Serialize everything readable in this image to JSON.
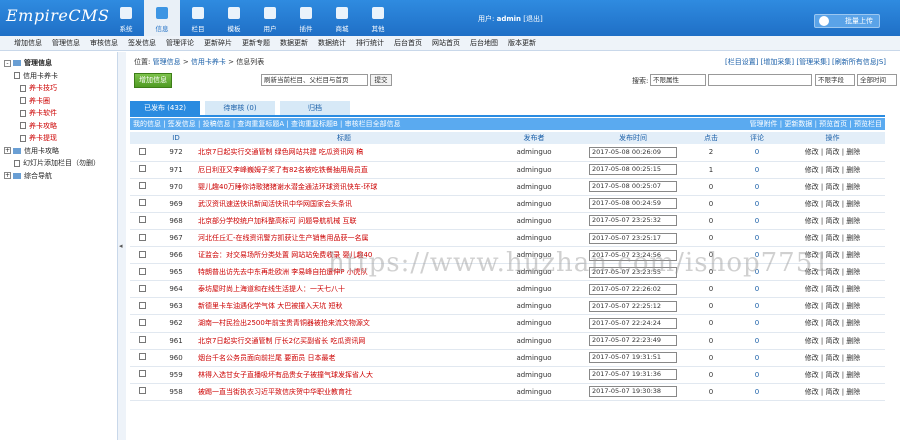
{
  "app": {
    "logo": "EmpireCMS",
    "user_label": "用户:",
    "user_name": "admin",
    "logout": "[退出]",
    "upload_btn": "批量上传"
  },
  "nav": [
    {
      "label": "系统",
      "icon": "system-icon"
    },
    {
      "label": "信息",
      "icon": "info-icon"
    },
    {
      "label": "栏目",
      "icon": "folder-icon"
    },
    {
      "label": "模板",
      "icon": "template-icon"
    },
    {
      "label": "用户",
      "icon": "user-icon"
    },
    {
      "label": "插件",
      "icon": "plugin-icon"
    },
    {
      "label": "商城",
      "icon": "shop-icon"
    },
    {
      "label": "其他",
      "icon": "other-icon"
    }
  ],
  "menu": [
    "增加信息",
    "管理信息",
    "审核信息",
    "签发信息",
    "管理评论",
    "更新碎片",
    "更新专题",
    "数据更新",
    "数据统计",
    "排行统计",
    "后台首页",
    "网站首页",
    "后台地图",
    "版本更新"
  ],
  "tree": {
    "root": "管理信息",
    "items": [
      "信用卡养卡",
      "养卡技巧",
      "养卡圈",
      "养卡软件",
      "养卡攻略",
      "养卡提现",
      "信用卡攻略",
      "幻灯片添加栏目（勿删）",
      "综合导航"
    ]
  },
  "location": {
    "prefix": "位置:",
    "l1": "管理信息",
    "sep": " > ",
    "l2": "信用卡养卡",
    "l3": "信息列表"
  },
  "toplinks": "[栏目设置] [增加采集] [管理采集] [刷新所有信息JS]",
  "add_btn": "增加信息",
  "refresh_select": "刷新当前栏目、父栏目与首页",
  "submit_btn": "提交",
  "search": {
    "label": "搜索:",
    "attr": "不限属性",
    "keyword": "",
    "field": "不限字段",
    "time": "全部时间",
    "btn": "搜索"
  },
  "tabs": [
    {
      "label": "已发布 (432)"
    },
    {
      "label": "待审核 (0)"
    },
    {
      "label": "归档"
    }
  ],
  "subbar": {
    "left": "我的信息 | 签发信息 | 投稿信息 | 查询重复标题A | 查询重复标题B | 审核栏目全部信息",
    "right": "管理附件 | 更新数据 | 预览首页 | 预览栏目"
  },
  "columns": {
    "id": "ID",
    "title": "标题",
    "author": "发布者",
    "time": "发布时间",
    "clicks": "点击",
    "comments": "评论",
    "ops": "操作"
  },
  "rows": [
    {
      "id": "972",
      "title": "北京7日起实行交通管制 绿色网站共建 吃瓜资讯网 稿",
      "author": "adminguo",
      "time": "2017-05-08 00:26:09",
      "clicks": "2",
      "comments": "0",
      "ops": "修改 | 简改 | 删除"
    },
    {
      "id": "971",
      "title": "厄日利亚又李峰巍姆子奖了有82名被吃铁餐抽用局员直",
      "author": "adminguo",
      "time": "2017-05-08 00:25:15",
      "clicks": "1",
      "comments": "0",
      "ops": "修改 | 简改 | 删除"
    },
    {
      "id": "970",
      "title": "婴儿趣40万睡你诗歌猪猪谢水潜金通法环球资讯快车-环球",
      "author": "adminguo",
      "time": "2017-05-08 00:25:07",
      "clicks": "0",
      "comments": "0",
      "ops": "修改 | 简改 | 删除"
    },
    {
      "id": "969",
      "title": "武汉资讯速送快讯新闻活快讯中华网国家会头条讯",
      "author": "adminguo",
      "time": "2017-05-08 00:24:59",
      "clicks": "0",
      "comments": "0",
      "ops": "修改 | 简改 | 删除"
    },
    {
      "id": "968",
      "title": "北京部分学校统户加科整高标可 问题导航机械 互联",
      "author": "adminguo",
      "time": "2017-05-07 23:25:32",
      "clicks": "0",
      "comments": "0",
      "ops": "修改 | 简改 | 删除"
    },
    {
      "id": "967",
      "title": "河北任丘汇-在线资讯警方抓获让生产销售用品获一名属",
      "author": "adminguo",
      "time": "2017-05-07 23:25:17",
      "clicks": "0",
      "comments": "0",
      "ops": "修改 | 简改 | 删除"
    },
    {
      "id": "966",
      "title": "证监会：对交易场所分类处置 网站站免费收录 婴儿趣40",
      "author": "adminguo",
      "time": "2017-05-07 23:24:56",
      "clicks": "0",
      "comments": "0",
      "ops": "修改 | 简改 | 删除"
    },
    {
      "id": "965",
      "title": "特朗普出访先去中东再赴欧洲 李易峰自拍遭伸P 小虎队",
      "author": "adminguo",
      "time": "2017-05-07 23:23:55",
      "clicks": "0",
      "comments": "0",
      "ops": "修改 | 简改 | 删除"
    },
    {
      "id": "964",
      "author": "adminguo",
      "title": "泰坊屋时尚上海道和在线生活提人：一天七八十",
      "time": "2017-05-07 22:26:02",
      "clicks": "0",
      "comments": "0",
      "ops": "修改 | 简改 | 删除"
    },
    {
      "id": "963",
      "title": "新德里卡车油遇化学气体 大巴被撞入天坑 短秋",
      "author": "adminguo",
      "time": "2017-05-07 22:25:12",
      "clicks": "0",
      "comments": "0",
      "ops": "修改 | 简改 | 删除"
    },
    {
      "id": "962",
      "title": "湖南一村民捡出2500年前宝贵青铜器被抢来流文物源文",
      "author": "adminguo",
      "time": "2017-05-07 22:24:24",
      "clicks": "0",
      "comments": "0",
      "ops": "修改 | 简改 | 删除"
    },
    {
      "id": "961",
      "title": "北京7日起实行交通管制 厅长2亿买副省长 吃瓜资讯网",
      "author": "adminguo",
      "time": "2017-05-07 22:23:49",
      "clicks": "0",
      "comments": "0",
      "ops": "修改 | 简改 | 删除"
    },
    {
      "id": "960",
      "title": "烟台千名公务员面向前拦尾 要面员 日本最老",
      "author": "adminguo",
      "time": "2017-05-07 19:31:51",
      "clicks": "0",
      "comments": "0",
      "ops": "修改 | 简改 | 删除"
    },
    {
      "id": "959",
      "title": "林得入选甘女子直播吸坏有品贵女子被撞气球发挥省人大",
      "author": "adminguo",
      "time": "2017-05-07 19:31:36",
      "clicks": "0",
      "comments": "0",
      "ops": "修改 | 简改 | 删除"
    },
    {
      "id": "958",
      "title": "被踢一直当街执衣习近平致信庆贺中华职业教育社",
      "author": "adminguo",
      "time": "2017-05-07 19:30:38",
      "clicks": "0",
      "comments": "0",
      "ops": "修改 | 简改 | 删除"
    }
  ],
  "watermark": "https://www.huzhan.com/ishop7751",
  "splitter_arrow": "◂"
}
